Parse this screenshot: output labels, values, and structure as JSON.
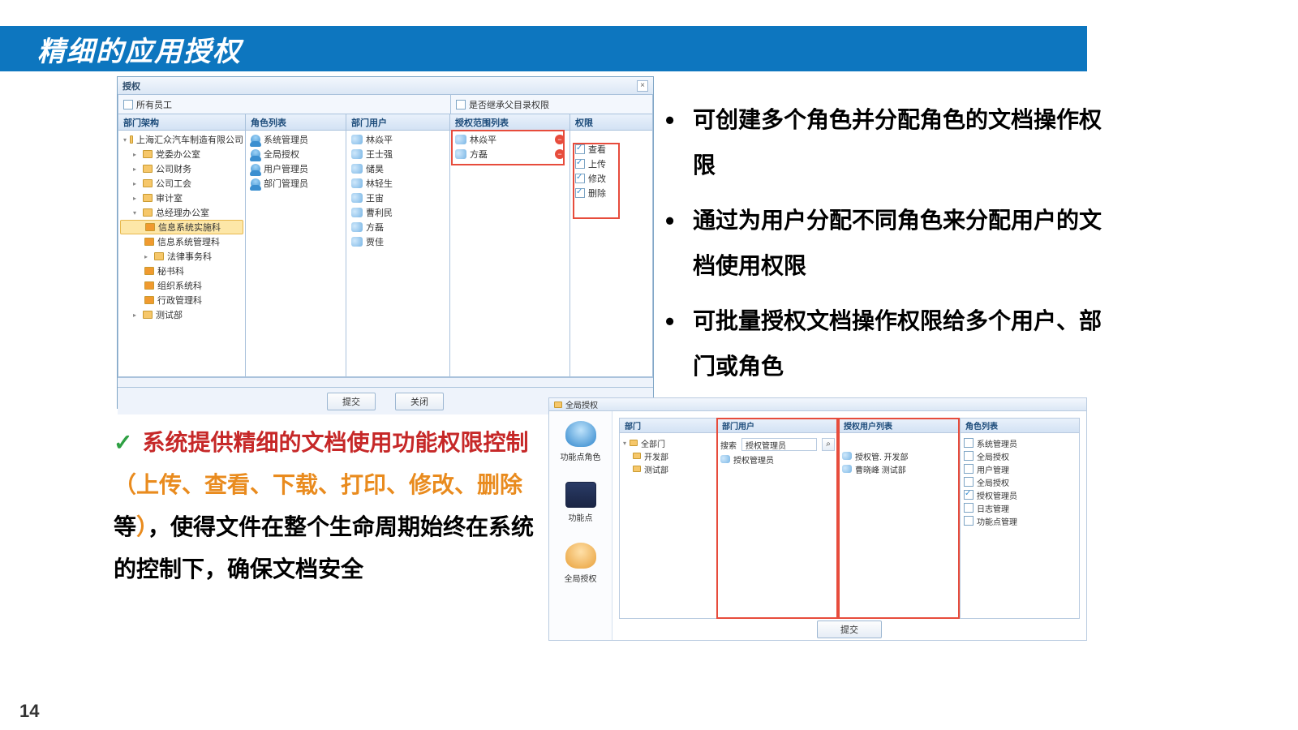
{
  "slide": {
    "title": "精细的应用授权",
    "page_number": "14"
  },
  "bullets": [
    "可创建多个角色并分配角色的文档操作权限",
    "通过为用户分配不同角色来分配用户的文档使用权限",
    "可批量授权文档操作权限给多个用户、部门或角色"
  ],
  "para": {
    "lead_red": "系统提供精细的文档使用功能权限控制",
    "paren_open": "（",
    "orange_list": "上传、查看、下载、打印、修改、删除",
    "tail_after_orange": "等",
    "paren_close": "）",
    "rest": "，使得文件在整个生命周期始终在系统的控制下，确保文档安全"
  },
  "auth": {
    "title": "授权",
    "top_left_checkbox": "所有员工",
    "top_right_checkbox": "是否继承父目录权限",
    "panes": {
      "dept": "部门架构",
      "roles": "角色列表",
      "users": "部门用户",
      "scope": "授权范围列表",
      "perm": "权限"
    },
    "dept_tree": {
      "root": "上海汇众汽车制造有限公司",
      "children": [
        "党委办公室",
        "公司财务",
        "公司工会",
        "审计室"
      ],
      "gm_office": "总经理办公室",
      "gm_children": [
        "信息系统实施科",
        "信息系统管理科",
        "法律事务科",
        "秘书科",
        "组织系统科",
        "行政管理科"
      ],
      "test_dept": "测试部"
    },
    "roles": [
      "系统管理员",
      "全局授权",
      "用户管理员",
      "部门管理员"
    ],
    "users": [
      "林焱平",
      "王士强",
      "储昊",
      "林轻生",
      "王宙",
      "曹利民",
      "方磊",
      "贾佳"
    ],
    "scope": [
      "林焱平",
      "方磊"
    ],
    "perms": [
      "查看",
      "上传",
      "修改",
      "删除"
    ],
    "buttons": {
      "submit": "提交",
      "close": "关闭"
    }
  },
  "sec": {
    "title": "全局授权",
    "sidebar": [
      "功能点角色",
      "功能点",
      "全局授权"
    ],
    "panes": {
      "dept": "部门",
      "users": "部门用户",
      "auth": "授权用户列表",
      "roles": "角色列表"
    },
    "dept_tree": [
      "全部门",
      "开发部",
      "测试部"
    ],
    "user_filter_label": "搜索",
    "user_filter_value": "授权管理员",
    "users": [
      "授权管理员"
    ],
    "auth_users": [
      "授权管.  开发部",
      "曹晓峰  测试部"
    ],
    "role_checks": [
      "系统管理员",
      "全局授权",
      "用户管理",
      "全局授权",
      "授权管理员",
      "日志管理",
      "功能点管理"
    ],
    "role_checked_index": 4,
    "submit": "提交"
  }
}
